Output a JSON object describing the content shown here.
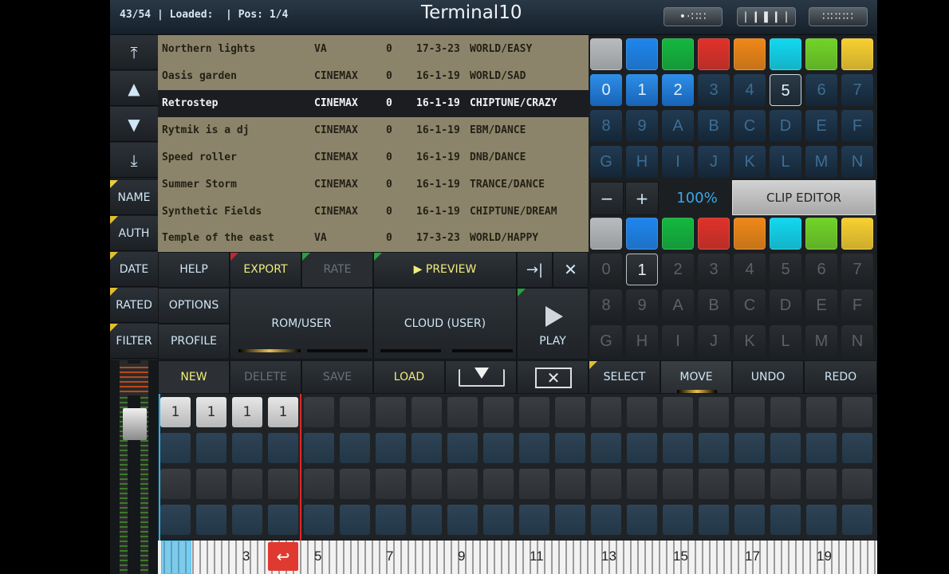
{
  "app": {
    "status": "43/54 | Loaded:  | Pos: 1/4",
    "title": "Terminal10"
  },
  "top_buttons": [
    "•·∷∷",
    "❘❙❚❙❘",
    "∷∷∷∷"
  ],
  "nav": {
    "arrows": [
      "⤒",
      "▲",
      "▼",
      "⤓"
    ],
    "items": [
      "NAME",
      "AUTH",
      "DATE",
      "RATED",
      "FILTER"
    ]
  },
  "list": {
    "rows": [
      {
        "name": "Northern lights",
        "author": "VA",
        "num": "0",
        "date": "17-3-23",
        "genre": "WORLD/EASY"
      },
      {
        "name": "Oasis garden",
        "author": "CINEMAX",
        "num": "0",
        "date": "16-1-19",
        "genre": "WORLD/SAD"
      },
      {
        "name": "Retrostep",
        "author": "CINEMAX",
        "num": "0",
        "date": "16-1-19",
        "genre": "CHIPTUNE/CRAZY"
      },
      {
        "name": "Rytmik is a dj",
        "author": "CINEMAX",
        "num": "0",
        "date": "16-1-19",
        "genre": "EBM/DANCE"
      },
      {
        "name": "Speed roller",
        "author": "CINEMAX",
        "num": "0",
        "date": "16-1-19",
        "genre": "DNB/DANCE"
      },
      {
        "name": "Summer Storm",
        "author": "CINEMAX",
        "num": "0",
        "date": "16-1-19",
        "genre": "TRANCE/DANCE"
      },
      {
        "name": "Synthetic Fields",
        "author": "CINEMAX",
        "num": "0",
        "date": "16-1-19",
        "genre": "CHIPTUNE/DREAM"
      },
      {
        "name": "Temple of the east",
        "author": "VA",
        "num": "0",
        "date": "17-3-23",
        "genre": "WORLD/HAPPY"
      }
    ],
    "selected_index": 2
  },
  "panel": {
    "help": "HELP",
    "export": "EXPORT",
    "rate": "RATE",
    "preview": "▶ PREVIEW",
    "options": "OPTIONS",
    "profile": "PROFILE",
    "rom_user": "ROM/USER",
    "cloud_user": "CLOUD (USER)",
    "play": "PLAY",
    "goto_icon": "→|",
    "close_icon": "✕"
  },
  "actions": {
    "new": "NEW",
    "delete": "DELETE",
    "save": "SAVE",
    "load": "LOAD",
    "select": "SELECT",
    "move": "MOVE",
    "undo": "UNDO",
    "redo": "REDO"
  },
  "pads": {
    "colors": [
      "#b9bcbf",
      "#1e86ee",
      "#14b840",
      "#e0322a",
      "#f08818",
      "#12d8f0",
      "#72d428",
      "#f8d030"
    ],
    "row1": [
      "0",
      "1",
      "2",
      "3",
      "4",
      "5",
      "6",
      "7"
    ],
    "row2": [
      "8",
      "9",
      "A",
      "B",
      "C",
      "D",
      "E",
      "F"
    ],
    "row3": [
      "G",
      "H",
      "I",
      "J",
      "K",
      "L",
      "M",
      "N"
    ],
    "minus": "−",
    "plus": "+",
    "zoom": "100%",
    "clip_editor": "CLIP EDITOR"
  },
  "sequencer": {
    "first_row_labels": [
      "1",
      "1",
      "1",
      "1"
    ],
    "timeline_numbers": [
      "3",
      "5",
      "7",
      "9",
      "11",
      "13",
      "15",
      "17",
      "19"
    ]
  }
}
